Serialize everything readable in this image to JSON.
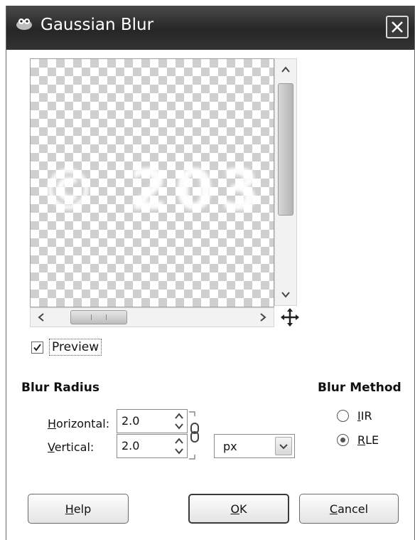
{
  "window": {
    "title": "Gaussian Blur"
  },
  "preview": {
    "image_text": "© 203",
    "checkbox_label": "Preview",
    "checkbox_checked": true
  },
  "blur_radius": {
    "heading": "Blur Radius",
    "horizontal_label_mnemonic": "H",
    "horizontal_label_rest": "orizontal:",
    "horizontal_value": "2.0",
    "vertical_label_mnemonic": "V",
    "vertical_label_rest": "ertical:",
    "vertical_value": "2.0",
    "unit": "px",
    "chained": true
  },
  "blur_method": {
    "heading": "Blur Method",
    "options": [
      {
        "mnemonic": "I",
        "rest": "IR",
        "selected": false
      },
      {
        "mnemonic": "R",
        "rest": "LE",
        "selected": true
      }
    ]
  },
  "buttons": {
    "help_mnemonic": "H",
    "help_rest": "elp",
    "ok_mnemonic": "O",
    "ok_rest": "K",
    "cancel_mnemonic": "C",
    "cancel_rest": "ancel"
  },
  "colors": {
    "titlebar": "#2e2e2e",
    "checker": "#cfcfcf"
  }
}
